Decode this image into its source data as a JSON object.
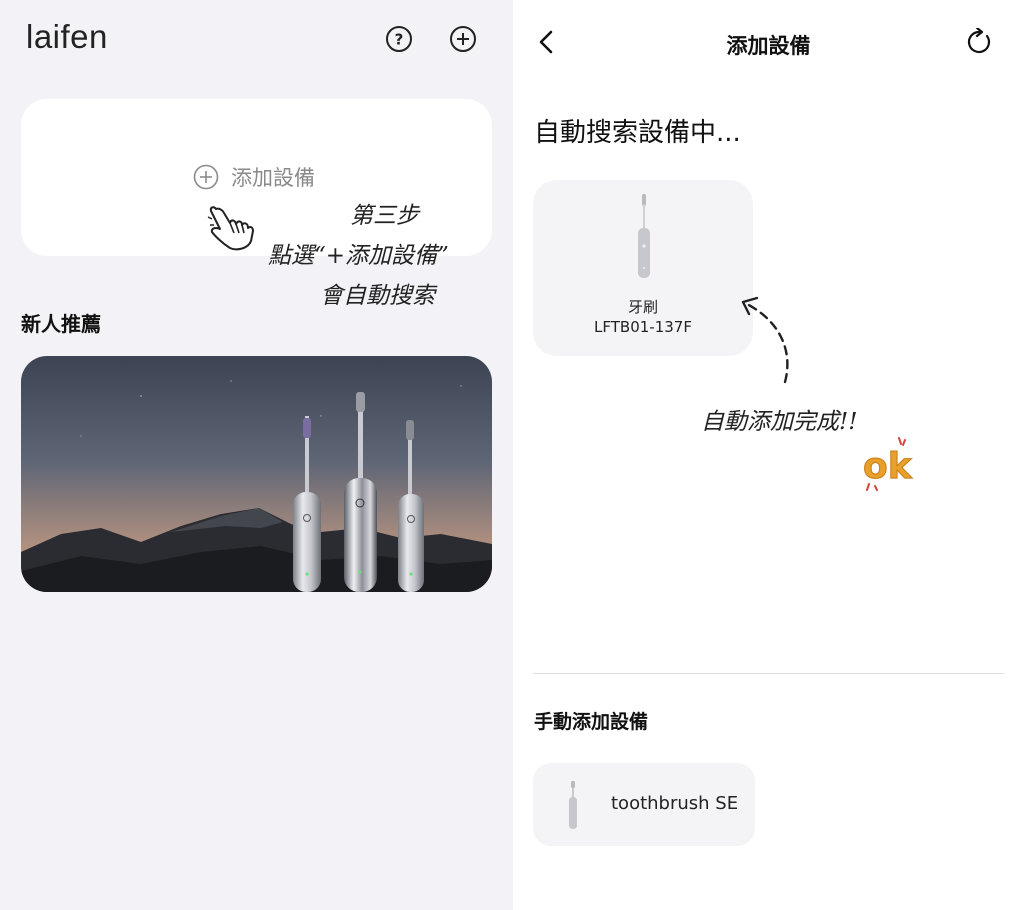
{
  "left_panel": {
    "logo": "laifen",
    "icons": {
      "help": "help-circle-icon",
      "add": "plus-circle-icon"
    },
    "add_card": {
      "label": "添加設備",
      "icon": "plus-circle-icon"
    },
    "section_title": "新人推薦",
    "banner": {
      "description_icon": "toothbrush-banner-image"
    },
    "annotation": {
      "line1": "第三步",
      "line2": "點選“+添加設備”",
      "line3": "會自動搜索"
    }
  },
  "right_panel": {
    "title": "添加設備",
    "icons": {
      "back": "chevron-left-icon",
      "refresh": "refresh-icon"
    },
    "search_status": "自動搜索設備中...",
    "found_device": {
      "name": "牙刷",
      "model": "LFTB01-137F"
    },
    "annotation": {
      "text": "自動添加完成!!",
      "badge": "ok"
    },
    "manual_section_title": "手動添加設備",
    "manual_device": {
      "label": "toothbrush SE"
    }
  },
  "colors": {
    "left_bg": "#f3f2f7",
    "card_bg": "#ffffff",
    "device_card_bg": "#f4f4f7",
    "ok_orange": "#e8a02a"
  }
}
